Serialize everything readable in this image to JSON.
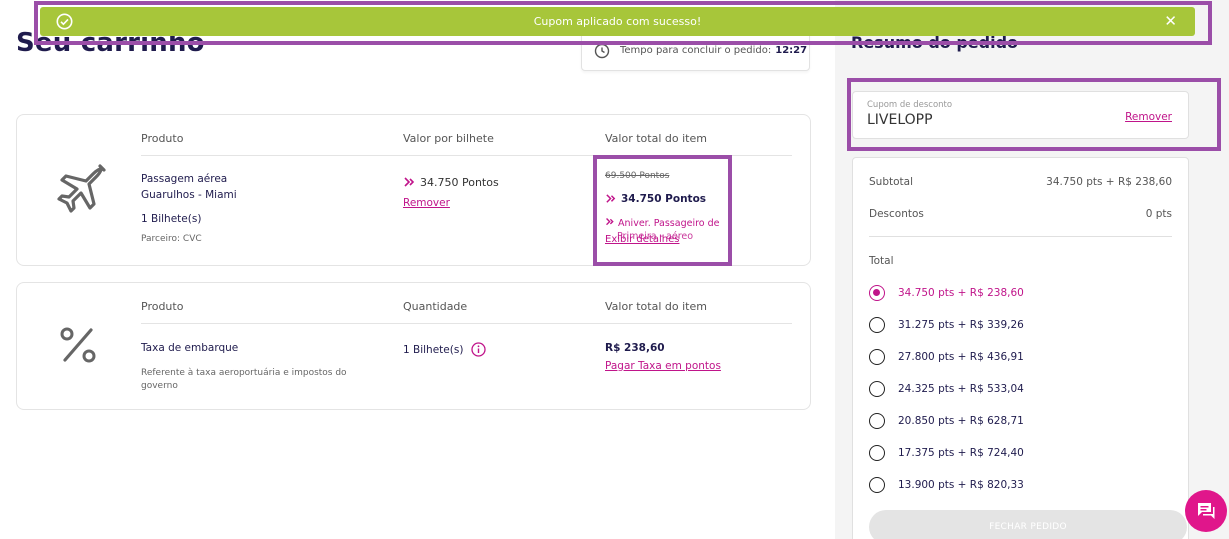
{
  "toast": {
    "message": "Cupom aplicado com sucesso!",
    "close_label": "✕"
  },
  "main": {
    "title": "Seu carrinho",
    "timer": {
      "label": "Tempo para concluir o pedido:",
      "value": "12:27"
    }
  },
  "flight": {
    "headers": {
      "product": "Produto",
      "per_ticket": "Valor por bilhete",
      "total": "Valor total do item"
    },
    "name_line1": "Passagem aérea",
    "name_line2": "Guarulhos - Miami",
    "tickets": "1 Bilhete(s)",
    "partner": "Parceiro: CVC",
    "per_ticket_points": "34.750 Pontos",
    "remove_label": "Remover",
    "old_total": "69.500 Pontos",
    "new_total": "34.750 Pontos",
    "promo_line1": "Aniver. Passageiro de",
    "promo_line2": "Primeira - aéreo",
    "details_link": "Exibir detalhes"
  },
  "fee": {
    "headers": {
      "product": "Produto",
      "quantity": "Quantidade",
      "total": "Valor total do item"
    },
    "name": "Taxa de embarque",
    "description": "Referente à taxa aeroportuária e impostos do governo",
    "quantity": "1 Bilhete(s)",
    "total": "R$ 238,60",
    "pay_link": "Pagar Taxa em pontos"
  },
  "sidebar": {
    "title": "Resumo do pedido",
    "coupon": {
      "label": "Cupom de desconto",
      "code": "LIVELOPP",
      "remove_label": "Remover"
    },
    "subtotal": {
      "label": "Subtotal",
      "value": "34.750 pts + R$ 238,60"
    },
    "discounts": {
      "label": "Descontos",
      "value": "0 pts"
    },
    "total_label": "Total",
    "options": [
      {
        "label": "34.750 pts + R$ 238,60",
        "selected": true
      },
      {
        "label": "31.275 pts + R$ 339,26",
        "selected": false
      },
      {
        "label": "27.800 pts + R$ 436,91",
        "selected": false
      },
      {
        "label": "24.325 pts + R$ 533,04",
        "selected": false
      },
      {
        "label": "20.850 pts + R$ 628,71",
        "selected": false
      },
      {
        "label": "17.375 pts + R$ 724,40",
        "selected": false
      },
      {
        "label": "13.900 pts + R$ 820,33",
        "selected": false
      }
    ],
    "close_order": "FECHAR PEDIDO"
  },
  "colors": {
    "accent": "#c0148a",
    "toast_green": "#a7c63a",
    "highlight": "#9b4ea8",
    "navy": "#1f1b4d"
  },
  "icons": [
    "check-circle-icon",
    "close-icon",
    "clock-icon",
    "airplane-icon",
    "points-icon",
    "percent-icon",
    "info-icon",
    "chat-icon"
  ]
}
